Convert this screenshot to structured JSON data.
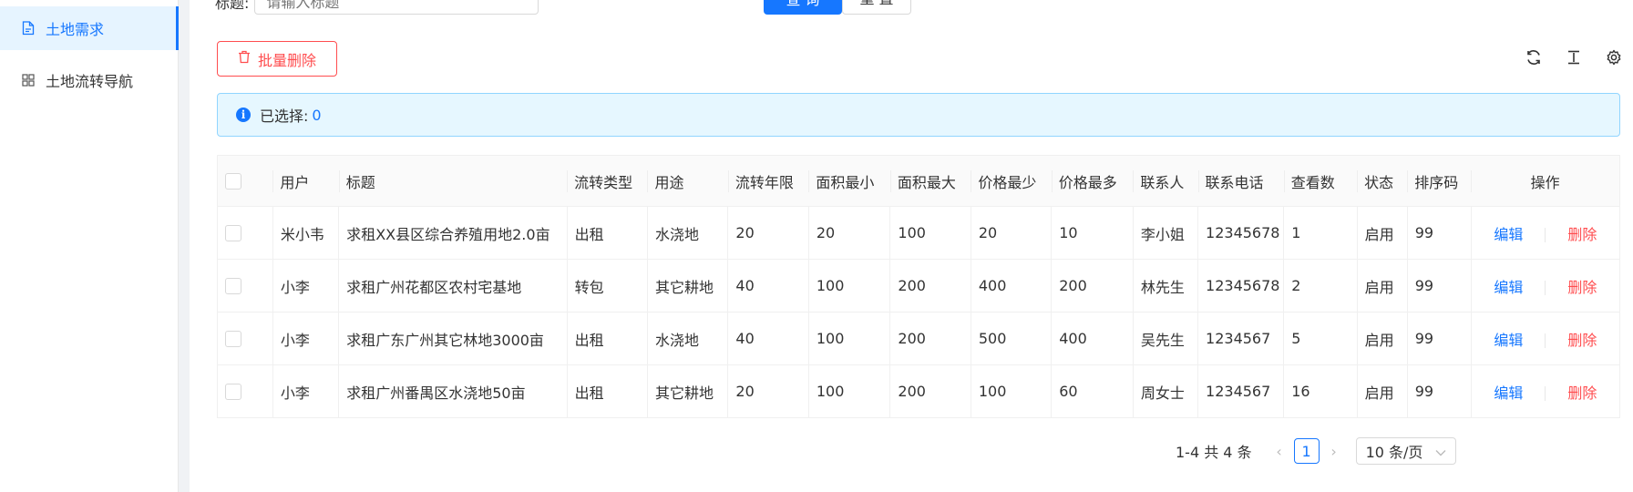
{
  "sidebar": {
    "items": [
      {
        "label": "土地需求",
        "icon": "file-icon",
        "active": true
      },
      {
        "label": "土地流转导航",
        "icon": "grid-icon",
        "active": false
      }
    ]
  },
  "search": {
    "title_label": "标题:",
    "title_placeholder": "请输入标题",
    "query_label": "查 询",
    "reset_label": "重 置"
  },
  "toolbar": {
    "batch_delete_label": "批量删除",
    "icons": [
      "reload-icon",
      "column-height-icon",
      "setting-icon"
    ]
  },
  "alert": {
    "selected_label": "已选择:",
    "selected_count": "0"
  },
  "table": {
    "columns": [
      "用户",
      "标题",
      "流转类型",
      "用途",
      "流转年限",
      "面积最小",
      "面积最大",
      "价格最少",
      "价格最多",
      "联系人",
      "联系电话",
      "查看数",
      "状态",
      "排序码",
      "操作"
    ],
    "rows": [
      [
        "米小韦",
        "求租XX县区综合养殖用地2.0亩",
        "出租",
        "水浇地",
        "20",
        "20",
        "100",
        "20",
        "10",
        "李小姐",
        "12345678",
        "1",
        "启用",
        "99"
      ],
      [
        "小李",
        "求租广州花都区农村宅基地",
        "转包",
        "其它耕地",
        "40",
        "100",
        "200",
        "400",
        "200",
        "林先生",
        "12345678",
        "2",
        "启用",
        "99"
      ],
      [
        "小李",
        "求租广东广州其它林地3000亩",
        "出租",
        "水浇地",
        "40",
        "100",
        "200",
        "500",
        "400",
        "吴先生",
        "1234567",
        "5",
        "启用",
        "99"
      ],
      [
        "小李",
        "求租广州番禺区水浇地50亩",
        "出租",
        "其它耕地",
        "20",
        "100",
        "200",
        "100",
        "60",
        "周女士",
        "1234567",
        "16",
        "启用",
        "99"
      ]
    ],
    "edit_label": "编辑",
    "delete_label": "删除"
  },
  "pagination": {
    "total_text": "1-4 共 4 条",
    "current_page": "1",
    "page_size": "10 条/页"
  },
  "colors": {
    "primary": "#1677ff",
    "danger": "#ff4d4f",
    "alert_bg": "#e6f7ff"
  }
}
